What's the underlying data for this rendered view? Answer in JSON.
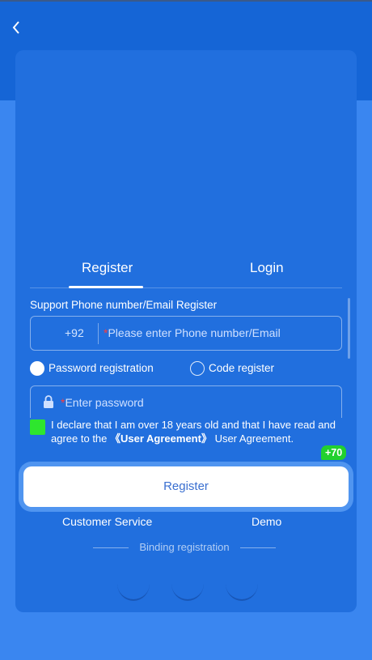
{
  "tabs": {
    "register": "Register",
    "login": "Login"
  },
  "form": {
    "support_label": "Support Phone number/Email Register",
    "country_code": "+92",
    "required_mark": "*",
    "phone_placeholder": "Please enter Phone number/Email",
    "password_placeholder": "Enter password"
  },
  "registration_type": {
    "password_label": "Password registration",
    "code_label": "Code register",
    "selected": "Password registration"
  },
  "agreement": {
    "checked": true,
    "text_before": "I declare that I am over 18 years old and that I have read and agree to the ",
    "link": "《User Agreement》",
    "text_after": " User Agreement."
  },
  "badge": "+70",
  "register_button": "Register",
  "footer": {
    "customer_service": "Customer Service",
    "demo": "Demo",
    "binding_label": "Binding registration"
  },
  "colors": {
    "background": "#3a86f0",
    "top_band": "#1565d6",
    "card": "#216fde",
    "checkbox": "#2ee62e",
    "badge": "#22d12e",
    "required": "#ff3b3b"
  },
  "icons": [
    "back-icon",
    "lock-icon"
  ]
}
